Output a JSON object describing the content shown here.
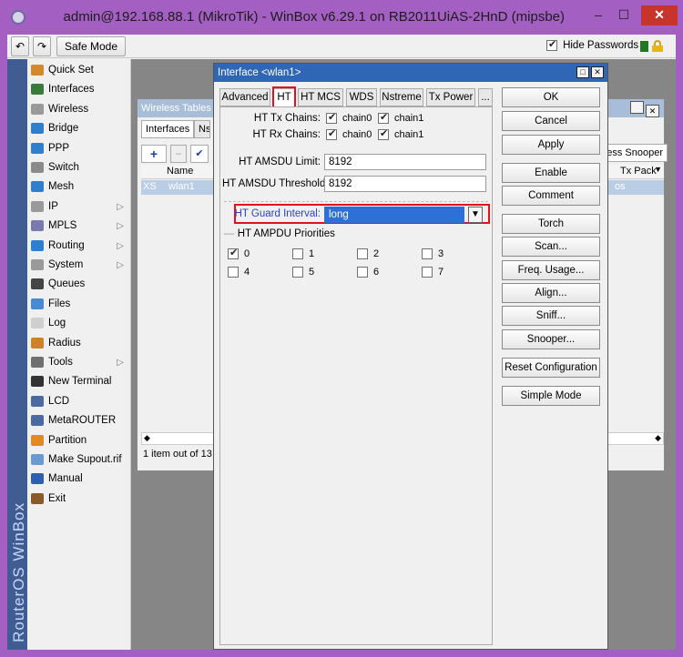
{
  "window": {
    "title": "admin@192.168.88.1 (MikroTik) - WinBox v6.29.1 on RB2011UiAS-2HnD (mipsbe)",
    "min_glyph": "–",
    "max_glyph": "☐",
    "close_glyph": "✕"
  },
  "toolbar": {
    "undo_glyph": "↶",
    "redo_glyph": "↷",
    "safe_mode_label": "Safe Mode",
    "hide_passwords_label": "Hide Passwords",
    "hide_passwords_checked": true
  },
  "sidebar": {
    "brand": "RouterOS WinBox",
    "items": [
      {
        "label": "Quick Set",
        "icon": "quick-set-icon",
        "color": "#d48a2a"
      },
      {
        "label": "Interfaces",
        "icon": "interfaces-icon",
        "color": "#3a7a3a"
      },
      {
        "label": "Wireless",
        "icon": "wireless-icon",
        "color": "#9a9a9a"
      },
      {
        "label": "Bridge",
        "icon": "bridge-icon",
        "color": "#2f7fcf"
      },
      {
        "label": "PPP",
        "icon": "ppp-icon",
        "color": "#2f7fcf"
      },
      {
        "label": "Switch",
        "icon": "switch-icon",
        "color": "#8a8a8a"
      },
      {
        "label": "Mesh",
        "icon": "mesh-icon",
        "color": "#2f7fcf"
      },
      {
        "label": "IP",
        "icon": "ip-icon",
        "color": "#9a9a9a",
        "submenu": true
      },
      {
        "label": "MPLS",
        "icon": "mpls-icon",
        "color": "#7a7ab0",
        "submenu": true
      },
      {
        "label": "Routing",
        "icon": "routing-icon",
        "color": "#2f7fcf",
        "submenu": true
      },
      {
        "label": "System",
        "icon": "system-icon",
        "color": "#9a9a9a",
        "submenu": true
      },
      {
        "label": "Queues",
        "icon": "queues-icon",
        "color": "#444"
      },
      {
        "label": "Files",
        "icon": "files-icon",
        "color": "#4a8ad0"
      },
      {
        "label": "Log",
        "icon": "log-icon",
        "color": "#cfcfcf"
      },
      {
        "label": "Radius",
        "icon": "radius-icon",
        "color": "#d0802a"
      },
      {
        "label": "Tools",
        "icon": "tools-icon",
        "color": "#707070",
        "submenu": true
      },
      {
        "label": "New Terminal",
        "icon": "terminal-icon",
        "color": "#333"
      },
      {
        "label": "LCD",
        "icon": "lcd-icon",
        "color": "#4a6aa0"
      },
      {
        "label": "MetaROUTER",
        "icon": "metarouter-icon",
        "color": "#4a6aa0"
      },
      {
        "label": "Partition",
        "icon": "partition-icon",
        "color": "#e08a20"
      },
      {
        "label": "Make Supout.rif",
        "icon": "supout-icon",
        "color": "#6a9ad0"
      },
      {
        "label": "Manual",
        "icon": "manual-icon",
        "color": "#2f5fb0"
      },
      {
        "label": "Exit",
        "icon": "exit-icon",
        "color": "#8a5a2a"
      }
    ]
  },
  "wireless_tables": {
    "title": "Wireless Tables",
    "tab_interfaces": "Interfaces",
    "tab_partial": "Nst",
    "col_name": "Name",
    "col_tx": "Tx Pack",
    "snooper_partial": "ess Snooper",
    "row_flag": "XS",
    "row_name": "wlan1",
    "row_partial": "os",
    "status": "1 item out of 13 ("
  },
  "dialog": {
    "title": "Interface <wlan1>",
    "tabs": [
      "Advanced",
      "HT",
      "HT MCS",
      "WDS",
      "Nstreme",
      "Tx Power",
      "..."
    ],
    "active_tab": "HT",
    "ht_tx_chains_label": "HT Tx Chains:",
    "ht_rx_chains_label": "HT Rx Chains:",
    "chain0": "chain0",
    "chain1": "chain1",
    "amsdu_limit_label": "HT AMSDU Limit:",
    "amsdu_limit_value": "8192",
    "amsdu_threshold_label": "HT AMSDU Threshold:",
    "amsdu_threshold_value": "8192",
    "guard_interval_label": "HT Guard Interval:",
    "guard_interval_value": "long",
    "ampdu_section": "HT AMPDU Priorities",
    "ampdu": [
      {
        "label": "0",
        "checked": true
      },
      {
        "label": "1",
        "checked": false
      },
      {
        "label": "2",
        "checked": false
      },
      {
        "label": "3",
        "checked": false
      },
      {
        "label": "4",
        "checked": false
      },
      {
        "label": "5",
        "checked": false
      },
      {
        "label": "6",
        "checked": false
      },
      {
        "label": "7",
        "checked": false
      }
    ],
    "buttons": [
      "OK",
      "Cancel",
      "Apply",
      "Enable",
      "Comment",
      "Torch",
      "Scan...",
      "Freq. Usage...",
      "Align...",
      "Sniff...",
      "Snooper...",
      "Reset Configuration",
      "Simple Mode"
    ]
  }
}
